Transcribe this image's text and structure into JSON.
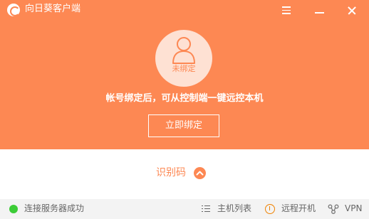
{
  "window": {
    "title": "向日葵客户端"
  },
  "account": {
    "status_label": "未绑定",
    "message": "帐号绑定后，可从控制端一键远控本机",
    "bind_button_label": "立即绑定"
  },
  "identification": {
    "label": "识别码"
  },
  "statusbar": {
    "connection_status": "连接服务器成功",
    "host_list_label": "主机列表",
    "remote_boot_label": "远程开机",
    "vpn_label": "VPN"
  },
  "colors": {
    "brand": "#fd8853",
    "avatar_bg": "#fee1d3",
    "status_ok": "#3ccc37",
    "remote_boot": "#f08200"
  },
  "icons": {
    "logo": "sunflower-logo",
    "menu": "hamburger-icon",
    "minimize": "minimize-icon",
    "close": "close-icon",
    "avatar": "user-icon",
    "toggle": "chevron-up-icon",
    "host_list": "list-icon",
    "remote_boot": "power-icon",
    "vpn": "network-icon"
  }
}
